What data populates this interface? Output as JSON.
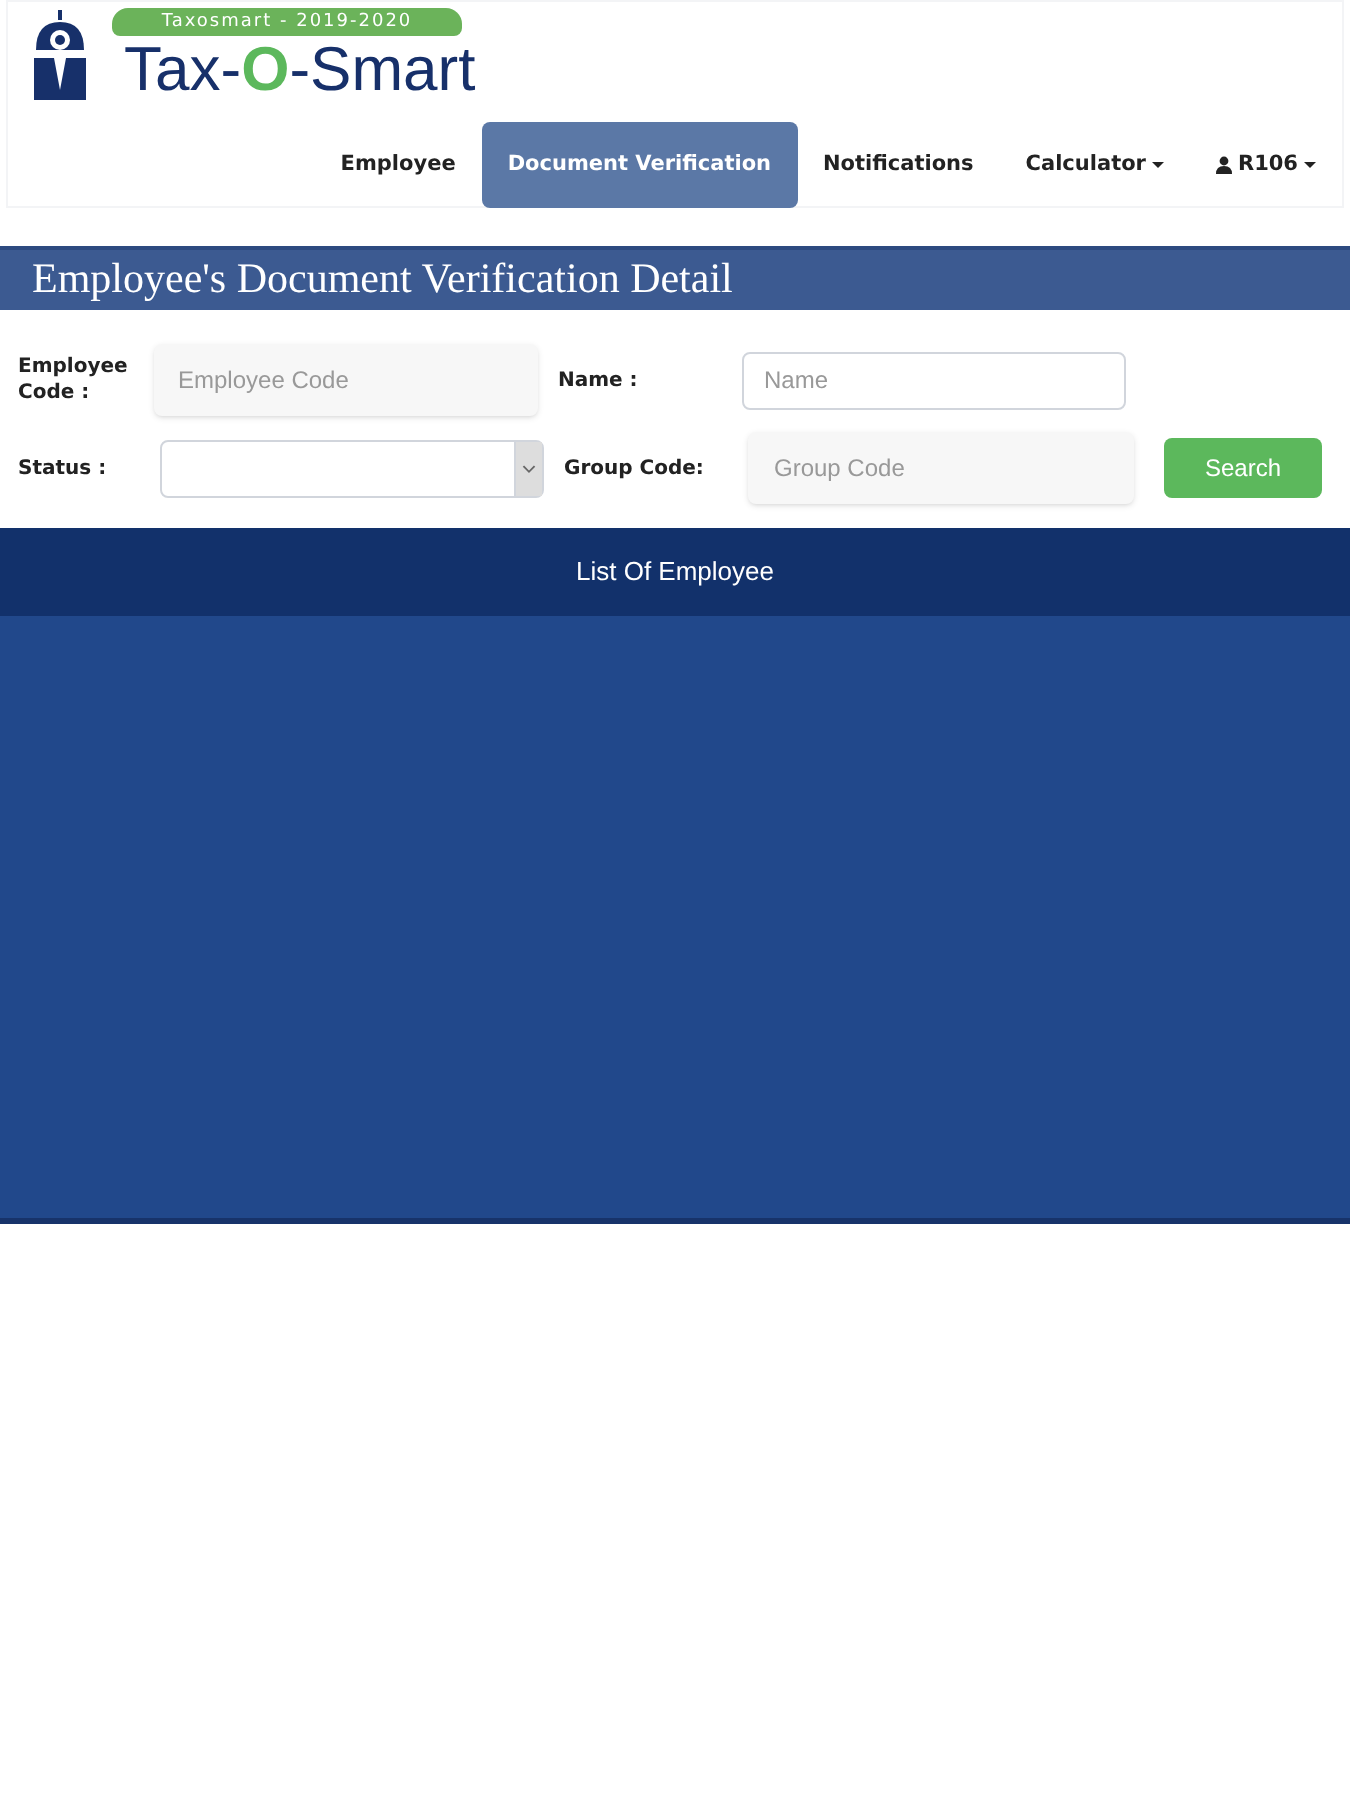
{
  "header": {
    "badge": "Taxosmart - 2019-2020",
    "logo_parts": [
      {
        "text": "Tax-",
        "highlight": false
      },
      {
        "text": "O",
        "highlight": true
      },
      {
        "text": "-Smart",
        "highlight": false
      }
    ]
  },
  "nav": [
    {
      "label": "Employee",
      "selected": false,
      "dropdown": false,
      "kind": "plain"
    },
    {
      "label": "Document Verification",
      "selected": true,
      "dropdown": false,
      "kind": "plain"
    },
    {
      "label": "Notifications",
      "selected": false,
      "dropdown": false,
      "kind": "plain"
    },
    {
      "label": "Calculator",
      "selected": false,
      "dropdown": true,
      "kind": "plain"
    },
    {
      "label": "R106",
      "selected": false,
      "dropdown": true,
      "kind": "user"
    }
  ],
  "page_title": "Employee's Document Verification Detail",
  "filters": {
    "employee_code": {
      "label": "Employee Code :",
      "placeholder": "Employee Code"
    },
    "name": {
      "label": "Name :",
      "placeholder": "Name"
    },
    "status": {
      "label": "Status :"
    },
    "group_code": {
      "label": "Group Code:",
      "placeholder": "Group Code"
    },
    "search_button": "Search"
  },
  "list": {
    "title": "List Of Employee"
  }
}
